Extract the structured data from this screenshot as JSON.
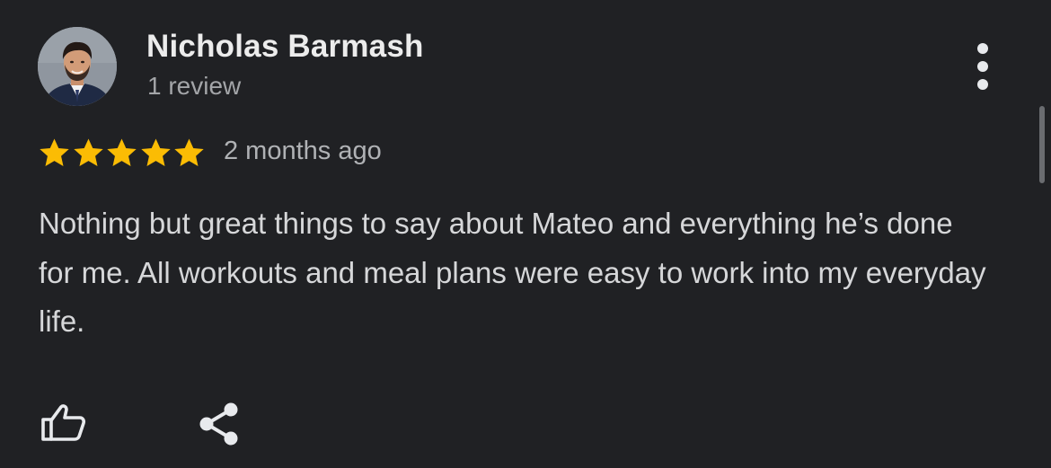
{
  "reviewer": {
    "name": "Nicholas Barmash",
    "review_count": "1 review",
    "avatar_icon": "profile-photo"
  },
  "rating": {
    "stars": 5,
    "max_stars": 5,
    "star_color": "#fbbc04",
    "date": "2 months ago"
  },
  "review": {
    "text": "Nothing but great things to say about Mateo and everything he’s done for me. All workouts and meal plans were easy to work into my everyday life."
  },
  "actions": {
    "like_icon": "thumbs-up-icon",
    "share_icon": "share-icon",
    "more_icon": "more-vert-icon"
  },
  "colors": {
    "background": "#202124",
    "primary_text": "#ececec",
    "secondary_text": "#a3a5a8"
  }
}
